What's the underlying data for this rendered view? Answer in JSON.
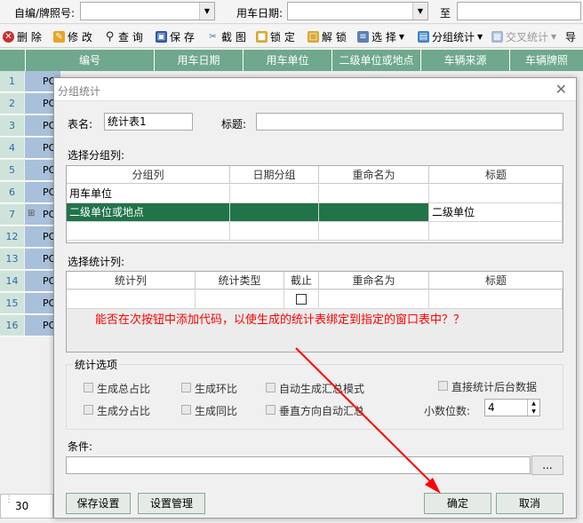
{
  "topbar": {
    "code_label": "自编/牌照号:",
    "date_label": "用车日期:",
    "to_label": "至"
  },
  "toolbar": {
    "delete": "删 除",
    "edit": "修 改",
    "query": "查 询",
    "save": "保 存",
    "screenshot": "截 图",
    "lock": "锁 定",
    "unlock": "解 锁",
    "select": "选 择",
    "group_stats": "分组统计",
    "cross_stats": "交叉统计",
    "export": "导"
  },
  "grid": {
    "headers": [
      "编号",
      "用车日期",
      "用车单位",
      "二级单位或地点",
      "车辆来源",
      "车辆牌照"
    ],
    "rows": [
      "1",
      "2",
      "3",
      "4",
      "5",
      "6",
      "7",
      "12",
      "13",
      "14",
      "15",
      "16"
    ],
    "cell_prefix": "PO",
    "footer_value": "30"
  },
  "dialog": {
    "title": "分组统计",
    "table_name_label": "表名:",
    "table_name_value": "统计表1",
    "caption_label": "标题:",
    "caption_value": "",
    "group_section_label": "选择分组列:",
    "group_headers": [
      "分组列",
      "日期分组",
      "重命名为",
      "标题"
    ],
    "group_rows": [
      {
        "col": "用车单位",
        "date": "",
        "rename": "",
        "title": ""
      },
      {
        "col": "二级单位或地点",
        "date": "",
        "rename": "",
        "title": "二级单位"
      }
    ],
    "stats_section_label": "选择统计列:",
    "stats_headers": [
      "统计列",
      "统计类型",
      "截止",
      "重命名为",
      "标题"
    ],
    "annotation": "能否在次按钮中添加代码，以使生成的统计表绑定到指定的窗口表中？？",
    "options_label": "统计选项",
    "options": [
      "生成总占比",
      "生成环比",
      "自动生成汇总模式",
      "生成分占比",
      "生成同比",
      "垂直方向自动汇总"
    ],
    "direct_stats": "直接统计后台数据",
    "decimals_label": "小数位数:",
    "decimals_value": "4",
    "condition_label": "条件:",
    "ellipsis": "...",
    "save_settings": "保存设置",
    "manage_settings": "设置管理",
    "ok": "确定",
    "cancel": "取消"
  },
  "colors": {
    "grid_header": "#6fa88c",
    "selected_row": "#21734a",
    "annotation": "#ff0000",
    "arrow": "#ff0000"
  }
}
